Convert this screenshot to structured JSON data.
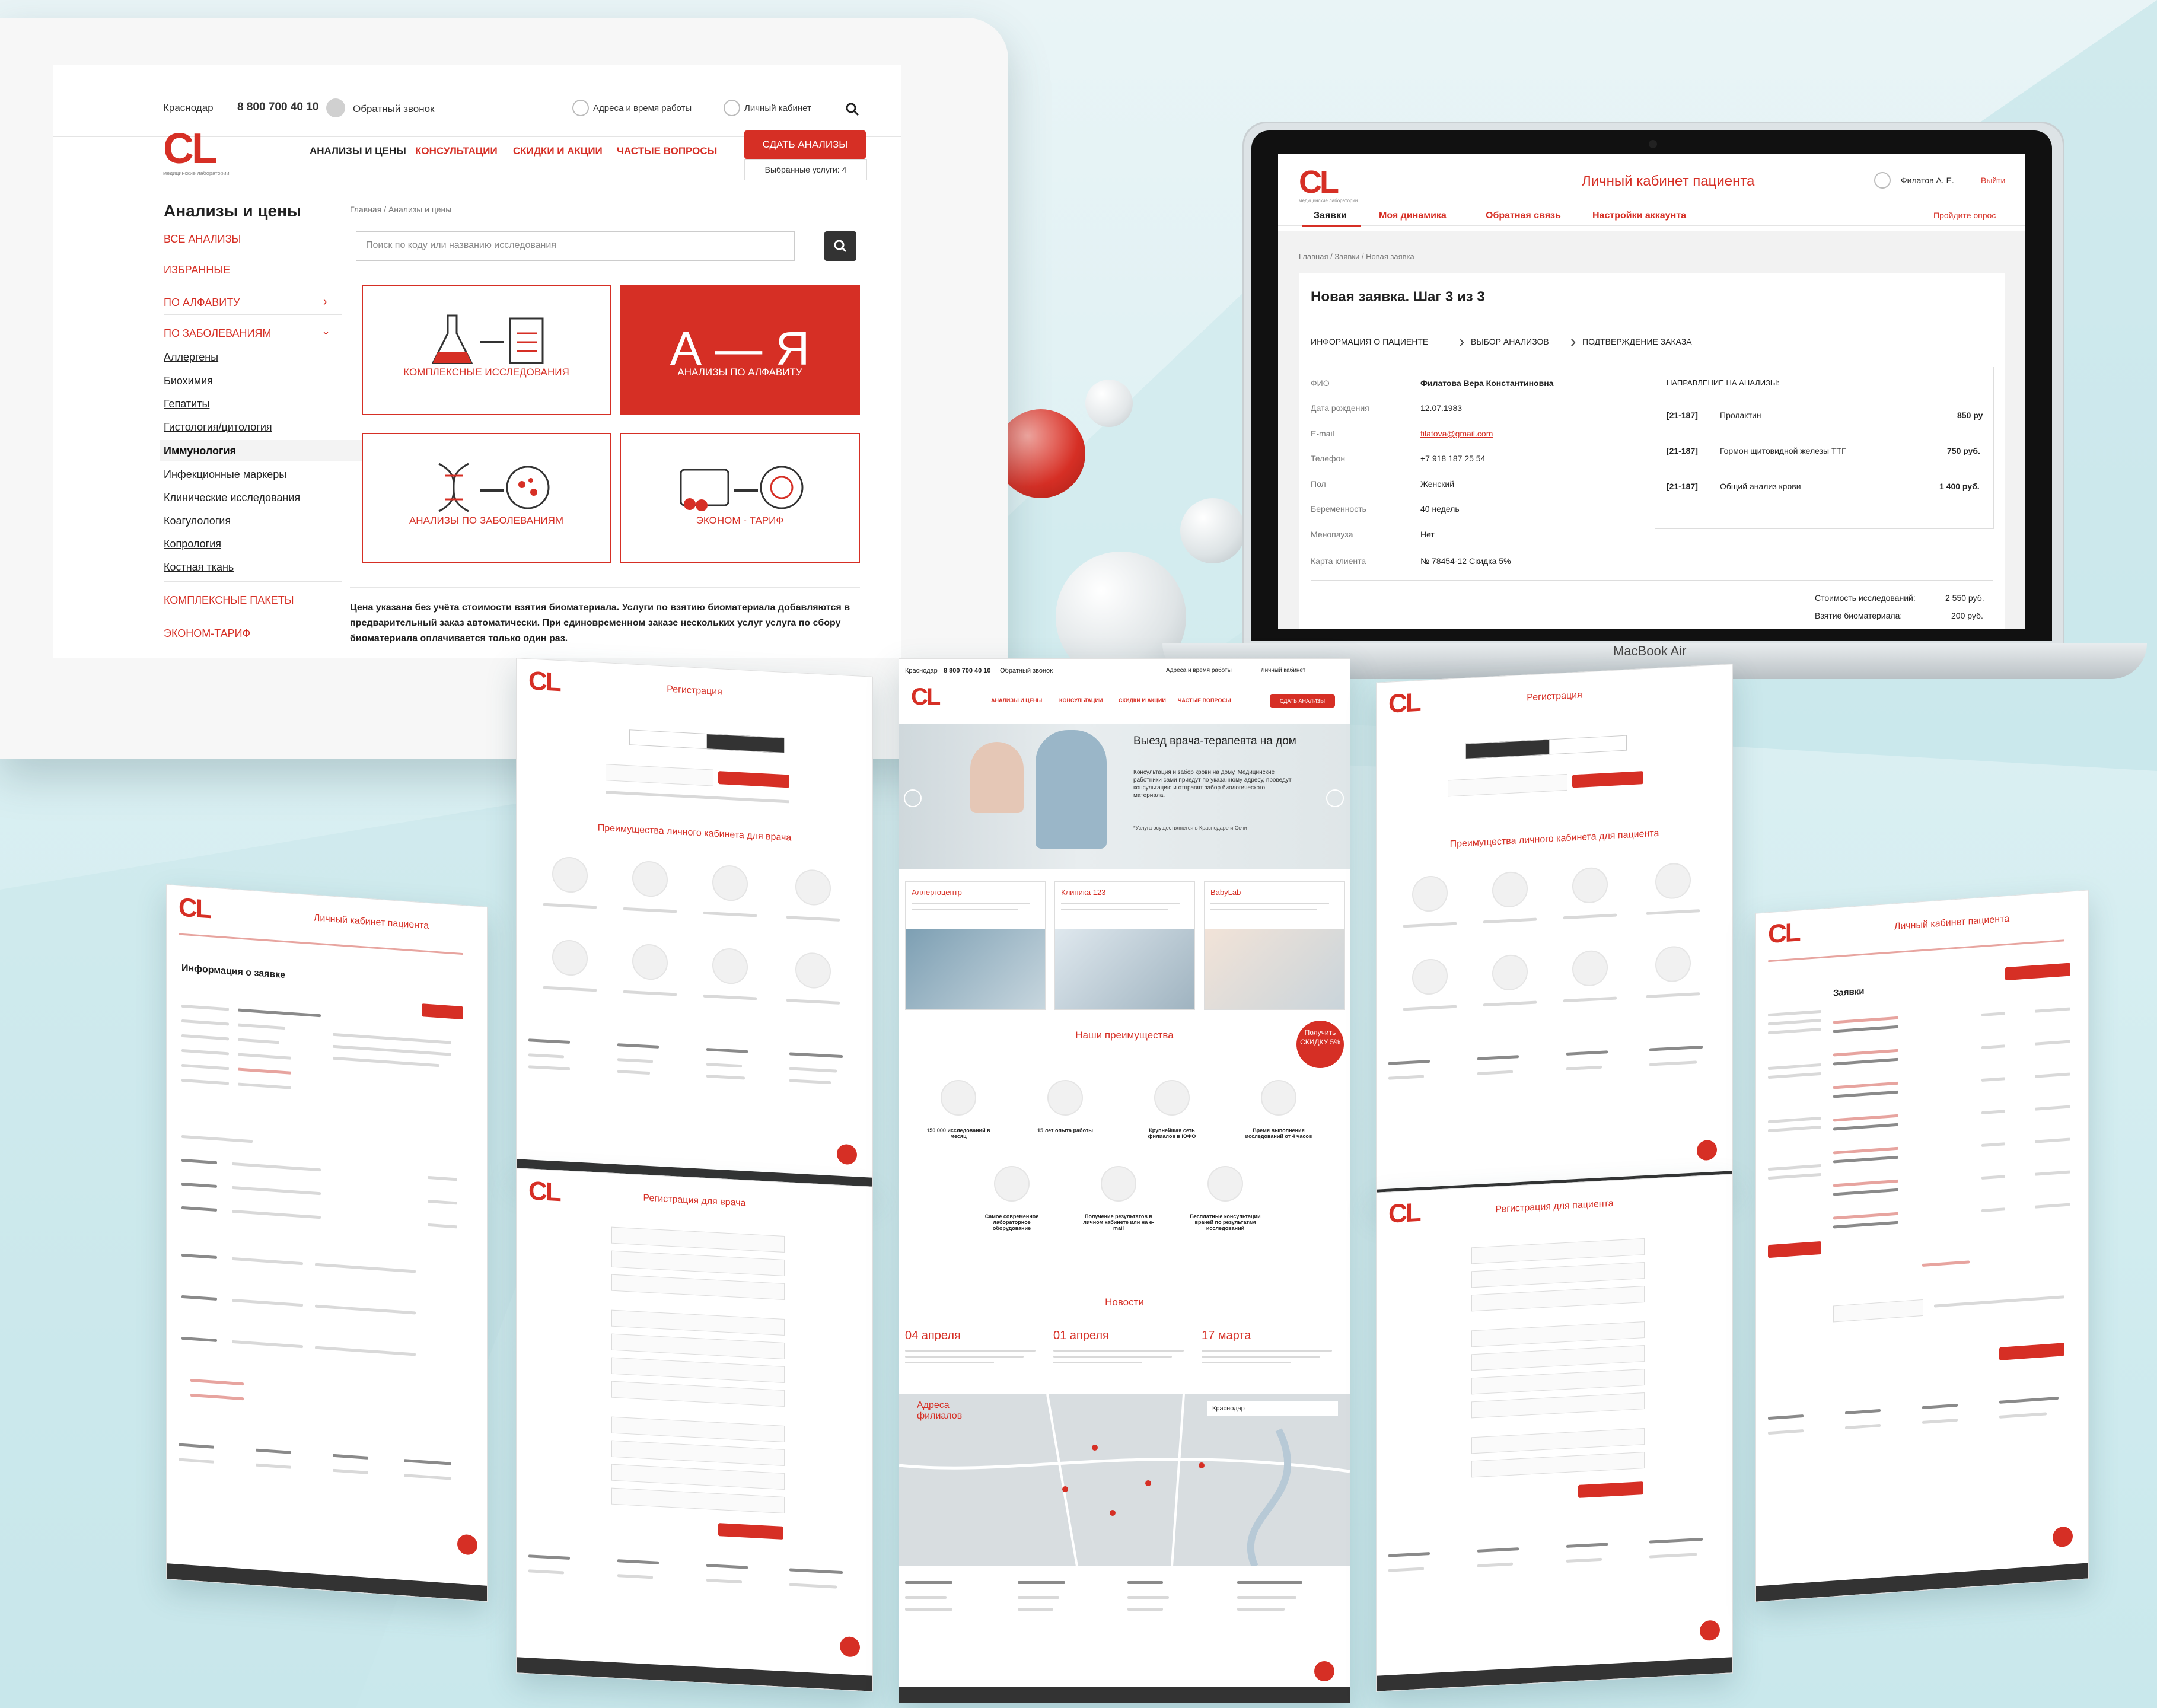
{
  "colors": {
    "accent": "#d62f25",
    "bg": "#d6eef1",
    "dark": "#333333"
  },
  "site": {
    "city": "Краснодар",
    "phone": "8 800 700 40 10",
    "callback": "Обратный звонок",
    "addresses": "Адреса и время работы",
    "cabinet": "Личный кабинет",
    "logo": "CL",
    "logo_sub": "медицинские лаборатории",
    "nav": [
      "АНАЛИЗЫ И ЦЕНЫ",
      "КОНСУЛЬТАЦИИ",
      "СКИДКИ И АКЦИИ",
      "ЧАСТЫЕ ВОПРОСЫ"
    ],
    "cta": "СДАТЬ АНАЛИЗЫ",
    "selected": "Выбранные услуги: 4"
  },
  "catalog": {
    "title": "Анализы и цены",
    "crumb": "Главная / Анализы и цены",
    "search_placeholder": "Поиск по коду или названию исследования",
    "menu": [
      "ВСЕ АНАЛИЗЫ",
      "ИЗБРАННЫЕ",
      "ПО АЛФАВИТУ",
      "ПО ЗАБОЛЕВАНИЯМ"
    ],
    "subs": [
      "Аллергены",
      "Биохимия",
      "Гепатиты",
      "Гистология/цитология",
      "Иммунология",
      "Инфекционные маркеры",
      "Клинические исследования",
      "Коагулология",
      "Копрология",
      "Костная ткань"
    ],
    "menu_bottom": [
      "КОМПЛЕКСНЫЕ ПАКЕТЫ",
      "ЭКОНОМ-ТАРИФ"
    ],
    "tiles": [
      "КОМПЛЕКСНЫЕ ИССЛЕДОВАНИЯ",
      "АНАЛИЗЫ ПО АЛФАВИТУ",
      "АНАЛИЗЫ ПО ЗАБОЛЕВАНИЯМ",
      "ЭКОНОМ - ТАРИФ"
    ],
    "az": "А — Я",
    "note": "Цена указана без учёта стоимости взятия биоматериала. Услуги по взятию биоматериала добавляются в предварительный заказ автоматически. При единовременном заказе нескольких услуг услуга по сбору биоматериала оплачивается только один раз."
  },
  "cabinet": {
    "title": "Личный кабинет пациента",
    "user": "Филатов А. Е.",
    "logout": "Выйти",
    "tabs": [
      "Заявки",
      "Моя динамика",
      "Обратная связь",
      "Настройки аккаунта"
    ],
    "help": "Пройдите опрос",
    "crumb": "Главная / Заявки / Новая заявка",
    "heading": "Новая заявка. Шаг 3 из 3",
    "steps": [
      "ИНФОРМАЦИЯ О ПАЦИЕНТЕ",
      "ВЫБОР АНАЛИЗОВ",
      "ПОДТВЕРЖДЕНИЕ ЗАКАЗА"
    ],
    "fields": [
      {
        "label": "ФИО",
        "value": "Филатова Вера Константиновна"
      },
      {
        "label": "Дата рождения",
        "value": "12.07.1983"
      },
      {
        "label": "E-mail",
        "value": "filatova@gmail.com"
      },
      {
        "label": "Телефон",
        "value": "+7 918 187 25 54"
      },
      {
        "label": "Пол",
        "value": "Женский"
      },
      {
        "label": "Беременность",
        "value": "40 недель"
      },
      {
        "label": "Менопауза",
        "value": "Нет"
      },
      {
        "label": "Карта клиента",
        "value": "№ 78454-12  Скидка 5%"
      }
    ],
    "orders_title": "НАПРАВЛЕНИЕ НА АНАЛИЗЫ:",
    "orders": [
      {
        "code": "[21-187]",
        "name": "Пролактин",
        "price": "850 ру"
      },
      {
        "code": "[21-187]",
        "name": "Гормон щитовидной железы ТТГ",
        "price": "750 руб."
      },
      {
        "code": "[21-187]",
        "name": "Общий анализ крови",
        "price": "1 400 руб."
      }
    ],
    "total_label": "Стоимость исследований:",
    "total": "2 550 руб.",
    "bio_label": "Взятие биоматериала:",
    "bio": "200 руб."
  },
  "macbook": "MacBook Air",
  "landing": {
    "hero_title": "Выезд врача-терапевта на дом",
    "hero_text": "Консультация и забор крови на дому. Медицинские работники сами приедут по указанному адресу, проведут консультацию и отправят забор биологического материала.",
    "hero_note": "*Услуга осуществляется в Краснодаре и Сочи",
    "clinics": [
      "Аллергоцентр",
      "Клиника 123",
      "BabyLab"
    ],
    "advantages": "Наши преимущества",
    "discount": "Получить СКИДКУ 5%",
    "adv_items": [
      "150 000 исследований в месяц",
      "15 лет опыта работы",
      "Крупнейшая сеть филиалов в ЮФО",
      "Время выполнения исследований от 4 часов",
      "Самое современное лабораторное оборудование",
      "Получение результатов в личном кабинете или на e-mail",
      "Бесплатные консультации врачей по результатам исследований"
    ],
    "news": "Новости",
    "news_dates": [
      "04 апреля",
      "01 апреля",
      "17 марта"
    ],
    "map_title": "Адреса филиалов",
    "map_city": "Краснодар"
  },
  "mini_titles": {
    "reg": "Регистрация",
    "reg_doc": "Регистрация для врача",
    "reg_pat": "Регистрация для пациента",
    "adv_doc": "Преимущества личного кабинета для врача",
    "adv_pat": "Преимущества личного кабинета для пациента",
    "info": "Информация о заявке",
    "orders": "Заявки"
  }
}
